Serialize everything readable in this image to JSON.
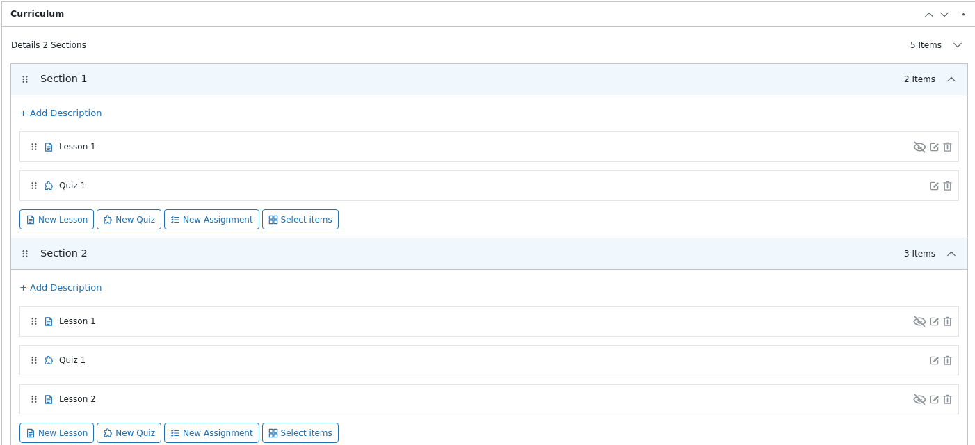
{
  "panel": {
    "title": "Curriculum"
  },
  "details": {
    "label": "Details",
    "sections_count": "2 Sections",
    "items_count": "5 Items"
  },
  "sections": [
    {
      "title": "Section 1",
      "items_count": "2 Items",
      "expanded": true,
      "add_description": "+ Add Description",
      "items": [
        {
          "kind": "lesson",
          "title": "Lesson 1"
        },
        {
          "kind": "quiz",
          "title": "Quiz 1"
        }
      ],
      "buttons": [
        {
          "kind": "lesson",
          "label": "New Lesson"
        },
        {
          "kind": "quiz",
          "label": "New Quiz"
        },
        {
          "kind": "assignment",
          "label": "New Assignment"
        },
        {
          "kind": "select",
          "label": "Select items"
        }
      ]
    },
    {
      "title": "Section 2",
      "items_count": "3 Items",
      "expanded": true,
      "add_description": "+ Add Description",
      "items": [
        {
          "kind": "lesson",
          "title": "Lesson 1"
        },
        {
          "kind": "quiz",
          "title": "Quiz 1"
        },
        {
          "kind": "lesson",
          "title": "Lesson 2"
        }
      ],
      "buttons": [
        {
          "kind": "lesson",
          "label": "New Lesson"
        },
        {
          "kind": "quiz",
          "label": "New Quiz"
        },
        {
          "kind": "assignment",
          "label": "New Assignment"
        },
        {
          "kind": "select",
          "label": "Select items"
        }
      ]
    }
  ]
}
